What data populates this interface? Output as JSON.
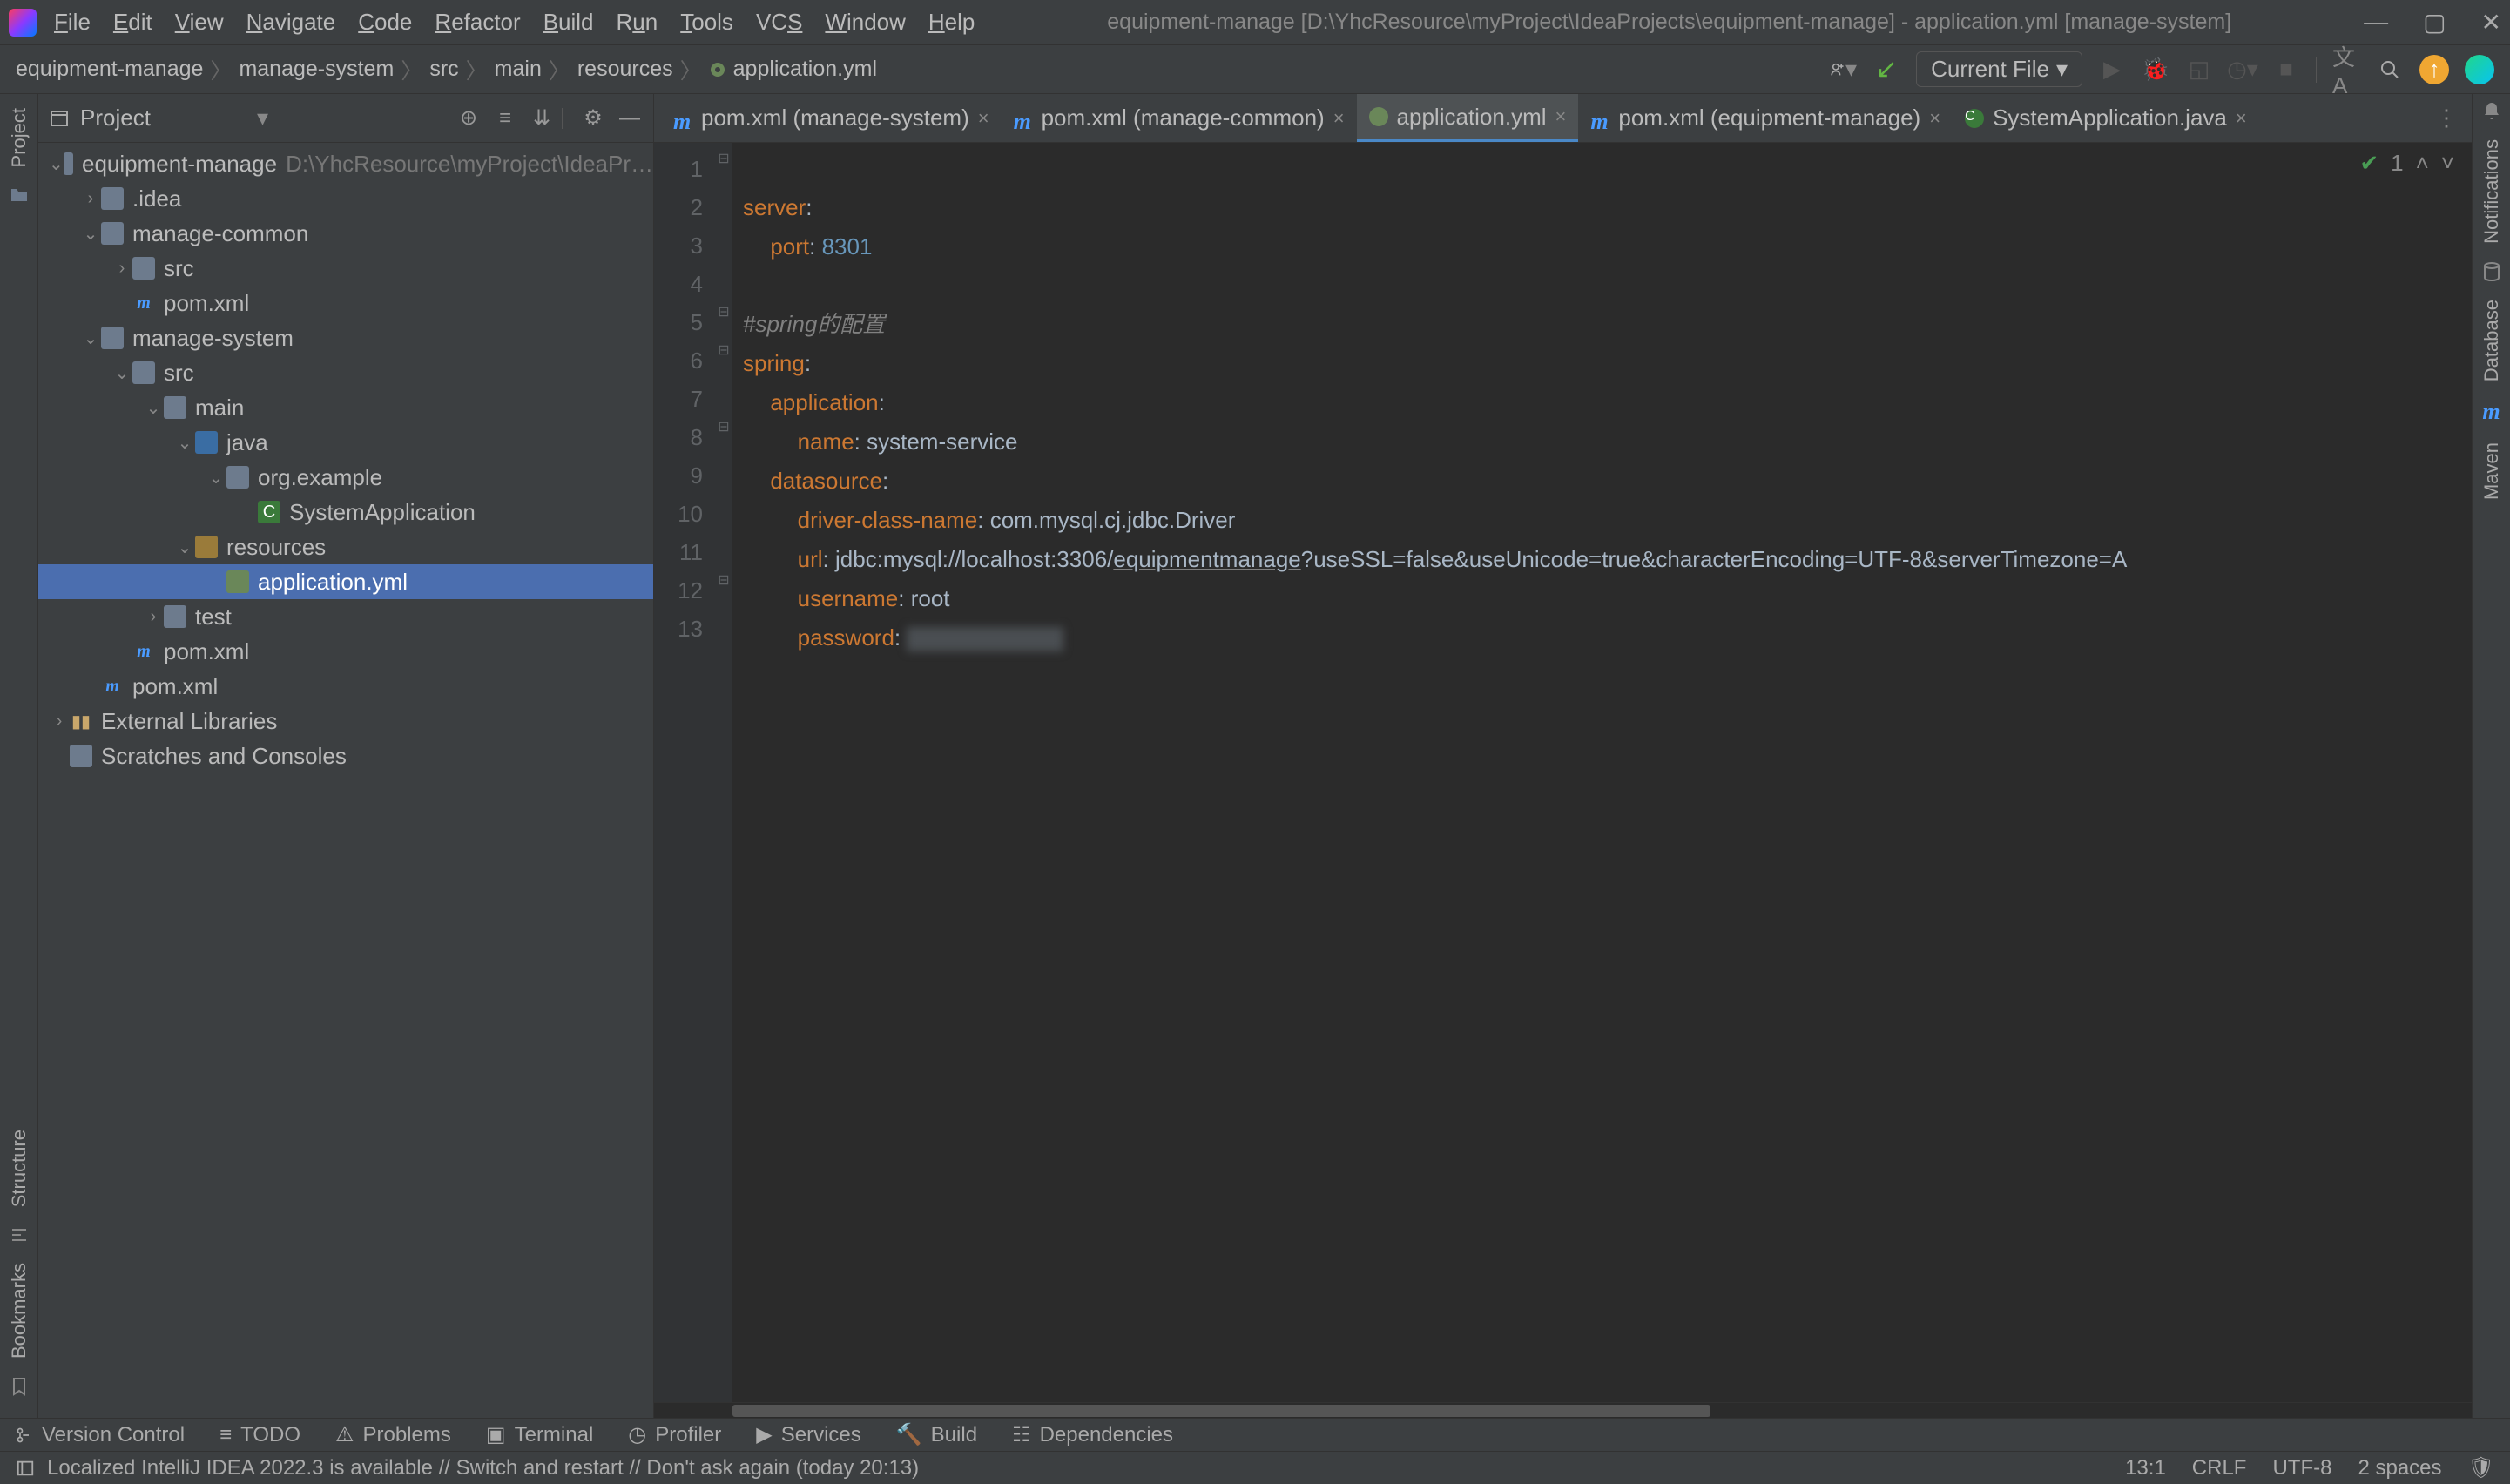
{
  "title": "equipment-manage [D:\\YhcResource\\myProject\\IdeaProjects\\equipment-manage] - application.yml [manage-system]",
  "menu": [
    "File",
    "Edit",
    "View",
    "Navigate",
    "Code",
    "Refactor",
    "Build",
    "Run",
    "Tools",
    "VCS",
    "Window",
    "Help"
  ],
  "breadcrumbs": [
    "equipment-manage",
    "manage-system",
    "src",
    "main",
    "resources",
    "application.yml"
  ],
  "runConfig": "Current File",
  "project": {
    "label": "Project",
    "root": "equipment-manage",
    "rootPath": "D:\\YhcResource\\myProject\\IdeaPr…",
    "tree": {
      "idea": ".idea",
      "manageCommon": "manage-common",
      "mcSrc": "src",
      "mcPom": "pom.xml",
      "manageSystem": "manage-system",
      "msSrc": "src",
      "main": "main",
      "java": "java",
      "pkg": "org.example",
      "sysApp": "SystemApplication",
      "resources": "resources",
      "appYml": "application.yml",
      "test": "test",
      "msPom": "pom.xml",
      "rootPom": "pom.xml",
      "extLib": "External Libraries",
      "scratches": "Scratches and Consoles"
    }
  },
  "tabs": [
    {
      "label": "pom.xml (manage-system)",
      "active": false,
      "type": "m"
    },
    {
      "label": "pom.xml (manage-common)",
      "active": false,
      "type": "m"
    },
    {
      "label": "application.yml",
      "active": true,
      "type": "yml"
    },
    {
      "label": "pom.xml (equipment-manage)",
      "active": false,
      "type": "m"
    },
    {
      "label": "SystemApplication.java",
      "active": false,
      "type": "c"
    }
  ],
  "code": {
    "l1a": "server",
    "l1b": ":",
    "l2a": "port",
    "l2b": ": ",
    "l2c": "8301",
    "l4": "#spring的配置",
    "l5a": "spring",
    "l5b": ":",
    "l6a": "application",
    "l6b": ":",
    "l7a": "name",
    "l7b": ": ",
    "l7c": "system-service",
    "l8a": "datasource",
    "l8b": ":",
    "l9a": "driver-class-name",
    "l9b": ": ",
    "l9c": "com.mysql.cj.jdbc.Driver",
    "l10a": "url",
    "l10b": ": ",
    "l10c": "jdbc:mysql://localhost:3306/",
    "l10d": "equipmentmanage",
    "l10e": "?useSSL=false&useUnicode=true&characterEncoding=UTF-8&serverTimezone=A",
    "l11a": "username",
    "l11b": ": ",
    "l11c": "root",
    "l12a": "password",
    "l12b": ": "
  },
  "inspections": "1",
  "toolwindows": [
    "Version Control",
    "TODO",
    "Problems",
    "Terminal",
    "Profiler",
    "Services",
    "Build",
    "Dependencies"
  ],
  "status": {
    "msg": "Localized IntelliJ IDEA 2022.3 is available // Switch and restart // Don't ask again (today 20:13)",
    "pos": "13:1",
    "eol": "CRLF",
    "enc": "UTF-8",
    "indent": "2 spaces"
  },
  "rightRail": [
    "Notifications",
    "Database",
    "Maven"
  ],
  "leftRail": [
    "Project",
    "Structure",
    "Bookmarks"
  ]
}
